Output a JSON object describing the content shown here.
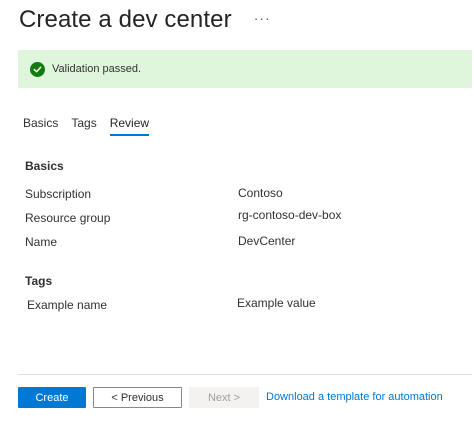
{
  "header": {
    "title": "Create a dev center",
    "more_label": "···"
  },
  "banner": {
    "message": "Validation passed.",
    "status_color": "#107c10",
    "background": "#dff6dd"
  },
  "tabs": [
    {
      "label": "Basics"
    },
    {
      "label": "Tags"
    },
    {
      "label": "Review",
      "active": true
    }
  ],
  "basics": {
    "heading": "Basics",
    "rows": [
      {
        "label": "Subscription",
        "value": "Contoso"
      },
      {
        "label": "Resource group",
        "value": "rg-contoso-dev-box"
      },
      {
        "label": "Name",
        "value": "DevCenter"
      }
    ]
  },
  "tags": {
    "heading": "Tags",
    "rows": [
      {
        "label": "Example name",
        "value": "Example value"
      }
    ]
  },
  "footer": {
    "create_label": "Create",
    "previous_label": "< Previous",
    "next_label": "Next >",
    "template_link": "Download a template for automation"
  },
  "colors": {
    "accent": "#0078d4"
  }
}
